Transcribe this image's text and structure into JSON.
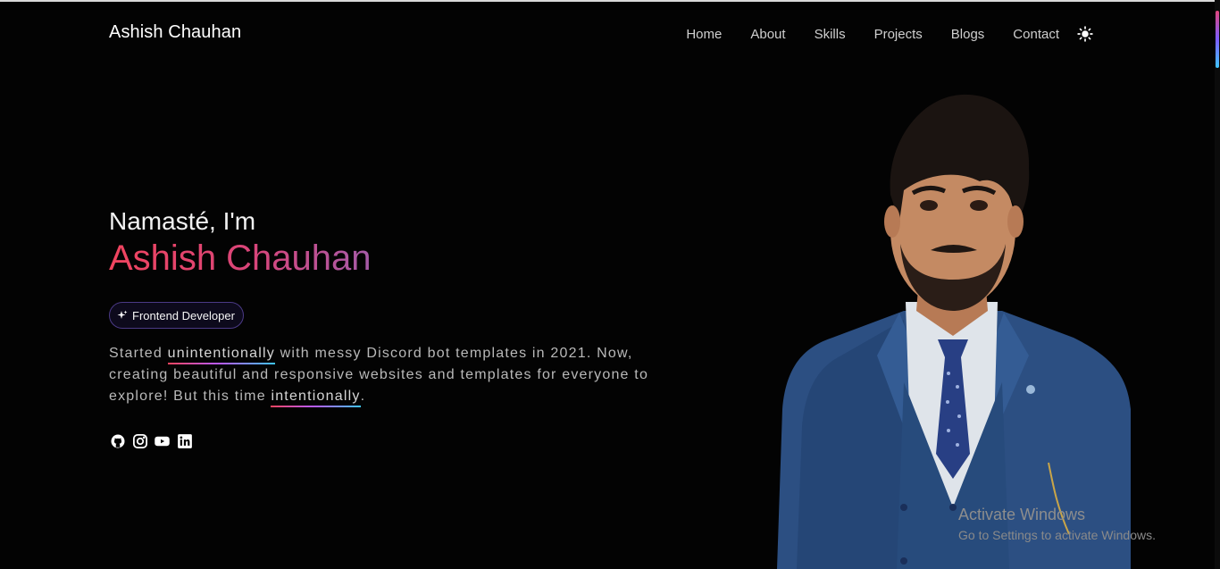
{
  "header": {
    "brand": "Ashish Chauhan",
    "nav": [
      "Home",
      "About",
      "Skills",
      "Projects",
      "Blogs",
      "Contact"
    ],
    "theme_icon": "sun-icon"
  },
  "hero": {
    "greeting": "Namasté, I'm",
    "name": "Ashish Chauhan",
    "role": "Frontend Developer",
    "role_icon": "sparkle-icon",
    "bio": {
      "part1": "Started ",
      "highlight1": "unintentionally",
      "part2": " with messy Discord bot templates in 2021. Now, creating beautiful and responsive websites and templates for everyone to explore! But this time ",
      "highlight2": "intentionally",
      "part3": "."
    },
    "socials": [
      "github-icon",
      "instagram-icon",
      "youtube-icon",
      "linkedin-icon"
    ]
  },
  "watermark": {
    "title": "Activate Windows",
    "subtitle": "Go to Settings to activate Windows."
  },
  "colors": {
    "background": "#030303",
    "name_gradient_start": "#f0445e",
    "name_gradient_end": "#a55ba8",
    "badge_border": "#4b3a86"
  }
}
